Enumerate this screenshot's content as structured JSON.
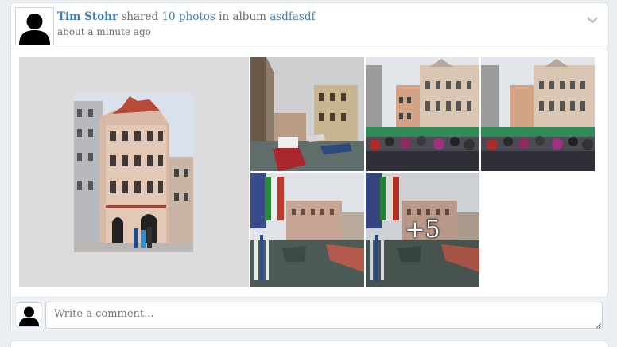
{
  "post": {
    "author": "Tim Stohr",
    "action_text": " shared ",
    "photo_link": "10 photos",
    "album_prefix": " in album ",
    "album_name": "asdfasdf",
    "timestamp": "about a minute ago",
    "menu_icon": "chevron-down-icon"
  },
  "gallery": {
    "photo_count": 10,
    "visible_thumbnails": 5,
    "more_label": "+5"
  },
  "comment": {
    "placeholder": "Write a comment..."
  },
  "colors": {
    "link": "#3b7db7",
    "meta_text": "#6b6b6b",
    "featured_bg": "#dcdcdc",
    "page_bg": "#e9eef3"
  }
}
